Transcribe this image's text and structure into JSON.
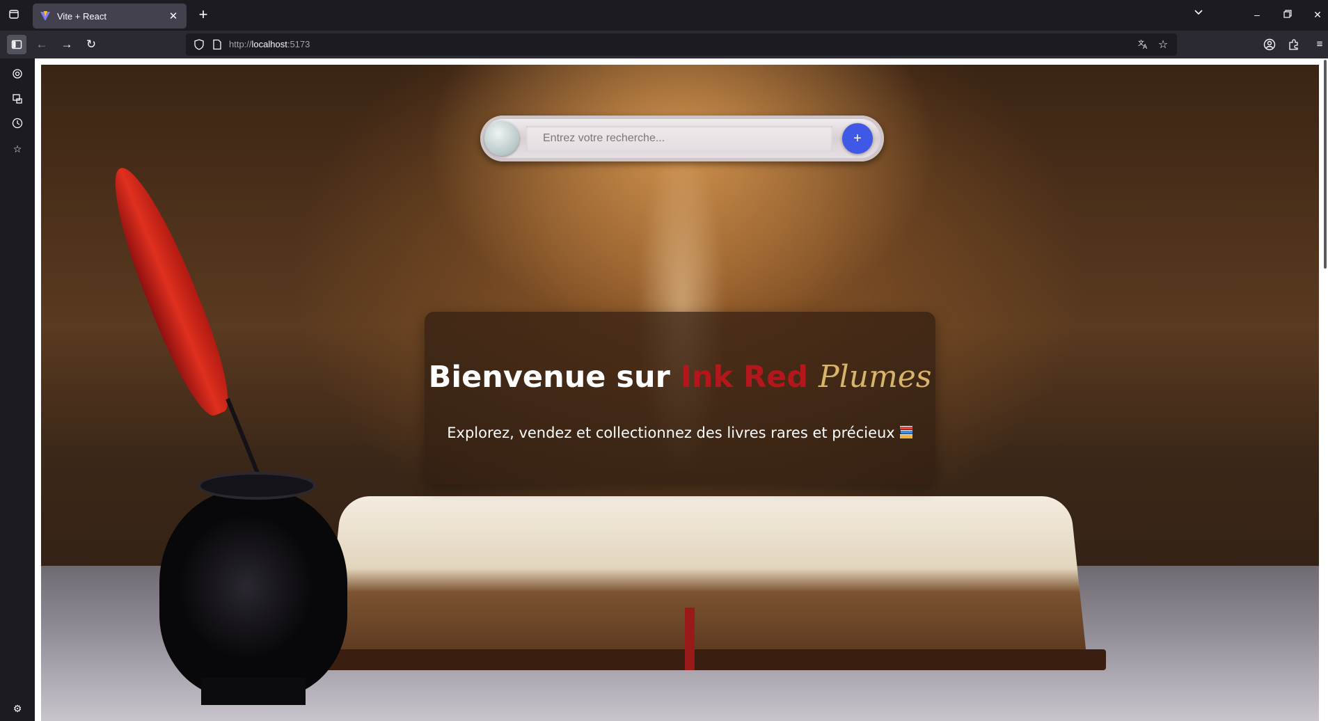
{
  "browser": {
    "tab": {
      "title": "Vite + React"
    },
    "url": {
      "scheme": "http://",
      "host": "localhost",
      "port": ":5173"
    }
  },
  "search": {
    "placeholder": "Entrez votre recherche...",
    "add_label": "+"
  },
  "hero": {
    "title_prefix": "Bienvenue sur ",
    "brand_name": "Ink Red",
    "brand_script": "Plumes",
    "subtitle": "Explorez, vendez et collectionnez des livres rares et précieux"
  },
  "colors": {
    "brand_red": "#b3171c",
    "script_gold": "#d8b46a",
    "add_button": "#3f58e6"
  },
  "icons": {
    "sidebar": [
      "ai-chatbot-icon",
      "synced-tabs-icon",
      "history-icon",
      "bookmarks-icon",
      "settings-icon"
    ]
  }
}
